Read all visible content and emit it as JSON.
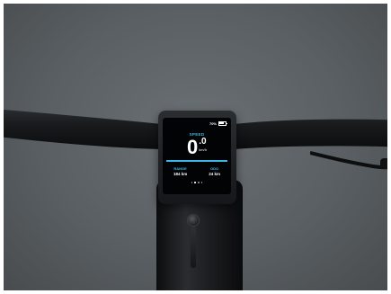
{
  "display": {
    "battery_text": "70%",
    "battery_level": 0.7,
    "speed_label": "SPEED",
    "speed_integer": "0",
    "speed_decimal": ".0",
    "speed_unit": "km/h",
    "stats": [
      {
        "label": "RANGE",
        "value": "184 km"
      },
      {
        "label": "ODO",
        "value": "24 km"
      }
    ],
    "page_indicator": {
      "count": 4,
      "active": 1
    }
  },
  "colors": {
    "accent": "#3ab6e6",
    "background": "#5f6468"
  }
}
